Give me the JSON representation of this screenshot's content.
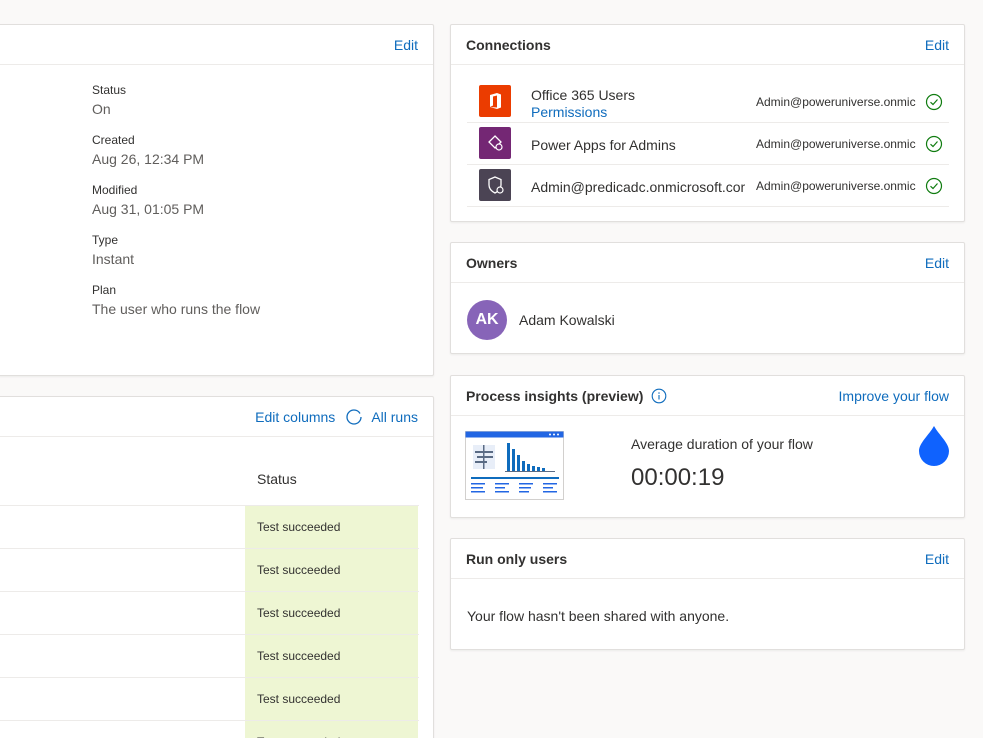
{
  "details": {
    "edit_label": "Edit",
    "fields": [
      {
        "label": "Status",
        "value": "On"
      },
      {
        "label": "Created",
        "value": "Aug 26, 12:34 PM"
      },
      {
        "label": "Modified",
        "value": "Aug 31, 01:05 PM"
      },
      {
        "label": "Type",
        "value": "Instant"
      },
      {
        "label": "Plan",
        "value": "The user who runs the flow"
      }
    ]
  },
  "runs": {
    "edit_columns_label": "Edit columns",
    "all_runs_label": "All runs",
    "status_header": "Status",
    "rows": [
      {
        "status": "Test succeeded"
      },
      {
        "status": "Test succeeded"
      },
      {
        "status": "Test succeeded"
      },
      {
        "status": "Test succeeded"
      },
      {
        "status": "Test succeeded"
      },
      {
        "status": "Test succeeded"
      }
    ]
  },
  "connections": {
    "title": "Connections",
    "edit_label": "Edit",
    "items": [
      {
        "name": "Office 365 Users",
        "sub": "Permissions",
        "account": "Admin@poweruniverse.onmic",
        "icon": "office-icon",
        "color": "#eb3c00"
      },
      {
        "name": "Power Apps for Admins",
        "account": "Admin@poweruniverse.onmic",
        "icon": "powerapps-admin-icon",
        "color": "#742774"
      },
      {
        "name": "Admin@predicadc.onmicrosoft.com",
        "account": "Admin@poweruniverse.onmic",
        "icon": "shield-admin-icon",
        "color": "#4b4454"
      }
    ]
  },
  "owners": {
    "title": "Owners",
    "edit_label": "Edit",
    "initials": "AK",
    "name": "Adam Kowalski"
  },
  "insights": {
    "title": "Process insights (preview)",
    "improve_label": "Improve your flow",
    "avg_label": "Average duration of your flow",
    "avg_value": "00:00:19"
  },
  "runonly": {
    "title": "Run only users",
    "edit_label": "Edit",
    "message": "Your flow hasn't been shared with anyone."
  }
}
